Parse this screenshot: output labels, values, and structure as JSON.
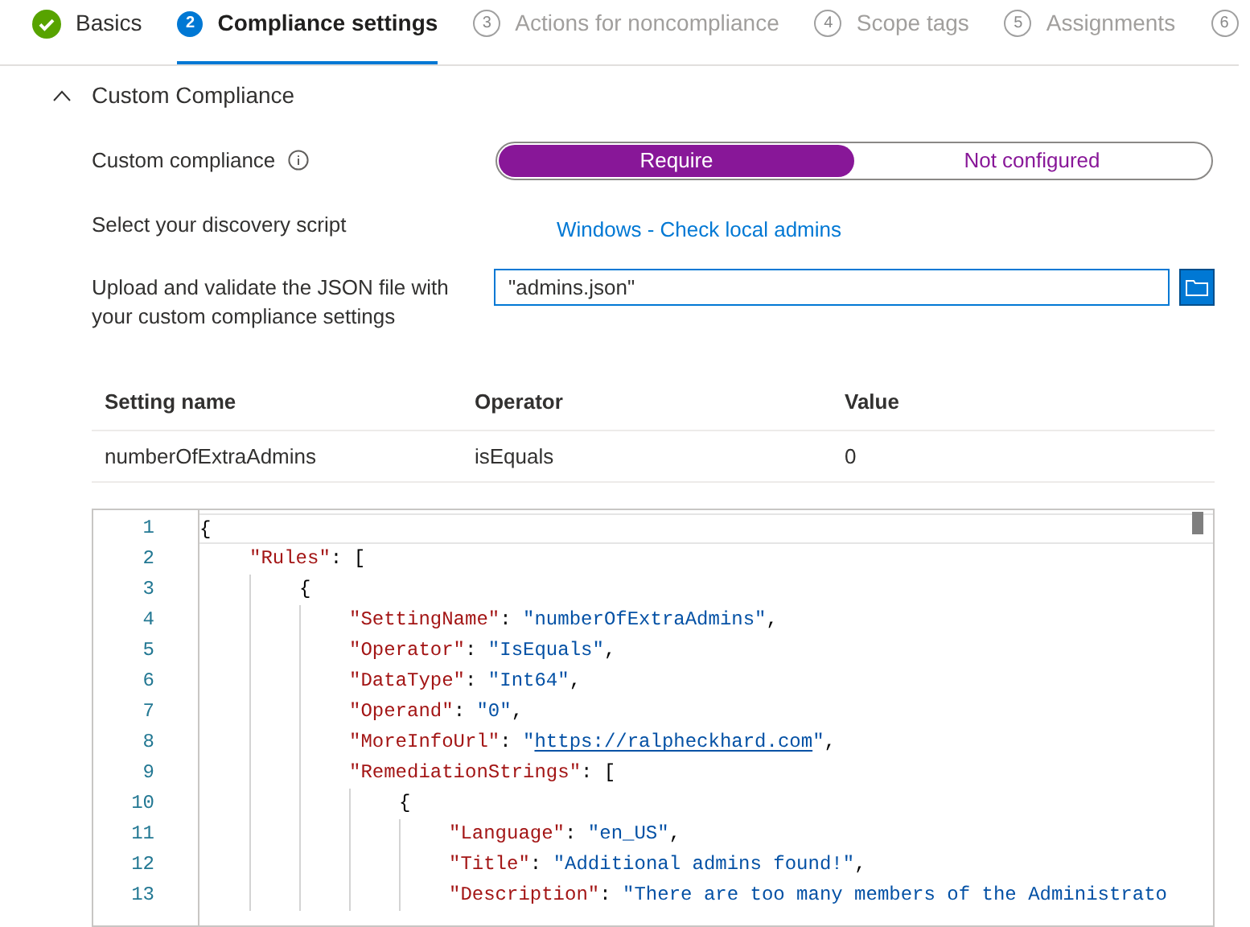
{
  "steps": [
    {
      "label": "Basics",
      "kind": "done",
      "selected": false
    },
    {
      "number": "2",
      "label": "Compliance settings",
      "kind": "current",
      "selected": true
    },
    {
      "number": "3",
      "label": "Actions for noncompliance",
      "kind": "upcoming",
      "selected": false
    },
    {
      "number": "4",
      "label": "Scope tags",
      "kind": "upcoming",
      "selected": false
    },
    {
      "number": "5",
      "label": "Assignments",
      "kind": "upcoming",
      "selected": false
    },
    {
      "number": "6",
      "kind": "upcoming",
      "selected": false
    }
  ],
  "section": {
    "title": "Custom Compliance",
    "expanded": true
  },
  "custom_compliance": {
    "label": "Custom compliance",
    "options": [
      {
        "label": "Require",
        "selected": true
      },
      {
        "label": "Not configured",
        "selected": false
      }
    ]
  },
  "discovery_script": {
    "label": "Select your discovery script",
    "value": "Windows - Check local admins"
  },
  "json_upload": {
    "label": "Upload and validate the JSON file with your custom compliance settings",
    "value": "\"admins.json\""
  },
  "table": {
    "columns": [
      "Setting name",
      "Operator",
      "Value"
    ],
    "rows": [
      [
        "numberOfExtraAdmins",
        "isEquals",
        "0"
      ]
    ]
  },
  "editor": {
    "lines": [
      {
        "number": "1",
        "tokens": [
          {
            "kind": "punct",
            "text": "{"
          }
        ],
        "children": [
          {
            "number": "2",
            "tokens": [
              {
                "kind": "key",
                "text": "\"Rules\""
              },
              {
                "kind": "punct",
                "text": ": ["
              }
            ],
            "children": [
              {
                "number": "3",
                "tokens": [
                  {
                    "kind": "punct",
                    "text": "{"
                  }
                ],
                "children": [
                  {
                    "number": "4",
                    "tokens": [
                      {
                        "kind": "key",
                        "text": "\"SettingName\""
                      },
                      {
                        "kind": "punct",
                        "text": ": "
                      },
                      {
                        "kind": "string",
                        "text": "\"numberOfExtraAdmins\""
                      },
                      {
                        "kind": "punct",
                        "text": ","
                      }
                    ]
                  },
                  {
                    "number": "5",
                    "tokens": [
                      {
                        "kind": "key",
                        "text": "\"Operator\""
                      },
                      {
                        "kind": "punct",
                        "text": ": "
                      },
                      {
                        "kind": "string",
                        "text": "\"IsEquals\""
                      },
                      {
                        "kind": "punct",
                        "text": ","
                      }
                    ]
                  },
                  {
                    "number": "6",
                    "tokens": [
                      {
                        "kind": "key",
                        "text": "\"DataType\""
                      },
                      {
                        "kind": "punct",
                        "text": ": "
                      },
                      {
                        "kind": "string",
                        "text": "\"Int64\""
                      },
                      {
                        "kind": "punct",
                        "text": ","
                      }
                    ]
                  },
                  {
                    "number": "7",
                    "tokens": [
                      {
                        "kind": "key",
                        "text": "\"Operand\""
                      },
                      {
                        "kind": "punct",
                        "text": ": "
                      },
                      {
                        "kind": "string",
                        "text": "\"0\""
                      },
                      {
                        "kind": "punct",
                        "text": ","
                      }
                    ]
                  },
                  {
                    "number": "8",
                    "tokens": [
                      {
                        "kind": "key",
                        "text": "\"MoreInfoUrl\""
                      },
                      {
                        "kind": "punct",
                        "text": ": "
                      },
                      {
                        "kind": "string",
                        "text": "\""
                      },
                      {
                        "kind": "link",
                        "text": "https://ralpheckhard.com"
                      },
                      {
                        "kind": "string",
                        "text": "\""
                      },
                      {
                        "kind": "punct",
                        "text": ","
                      }
                    ]
                  },
                  {
                    "number": "9",
                    "tokens": [
                      {
                        "kind": "key",
                        "text": "\"RemediationStrings\""
                      },
                      {
                        "kind": "punct",
                        "text": ": ["
                      }
                    ],
                    "children": [
                      {
                        "number": "10",
                        "tokens": [
                          {
                            "kind": "punct",
                            "text": "{"
                          }
                        ],
                        "children": [
                          {
                            "number": "11",
                            "tokens": [
                              {
                                "kind": "key",
                                "text": "\"Language\""
                              },
                              {
                                "kind": "punct",
                                "text": ": "
                              },
                              {
                                "kind": "string",
                                "text": "\"en_US\""
                              },
                              {
                                "kind": "punct",
                                "text": ","
                              }
                            ]
                          },
                          {
                            "number": "12",
                            "tokens": [
                              {
                                "kind": "key",
                                "text": "\"Title\""
                              },
                              {
                                "kind": "punct",
                                "text": ": "
                              },
                              {
                                "kind": "string",
                                "text": "\"Additional admins found!\""
                              },
                              {
                                "kind": "punct",
                                "text": ","
                              }
                            ]
                          },
                          {
                            "number": "13",
                            "tokens": [
                              {
                                "kind": "key",
                                "text": "\"Description\""
                              },
                              {
                                "kind": "punct",
                                "text": ": "
                              },
                              {
                                "kind": "string",
                                "text": "\"There are too many members of the Administrato"
                              }
                            ]
                          }
                        ]
                      }
                    ]
                  }
                ]
              }
            ]
          }
        ]
      }
    ]
  }
}
